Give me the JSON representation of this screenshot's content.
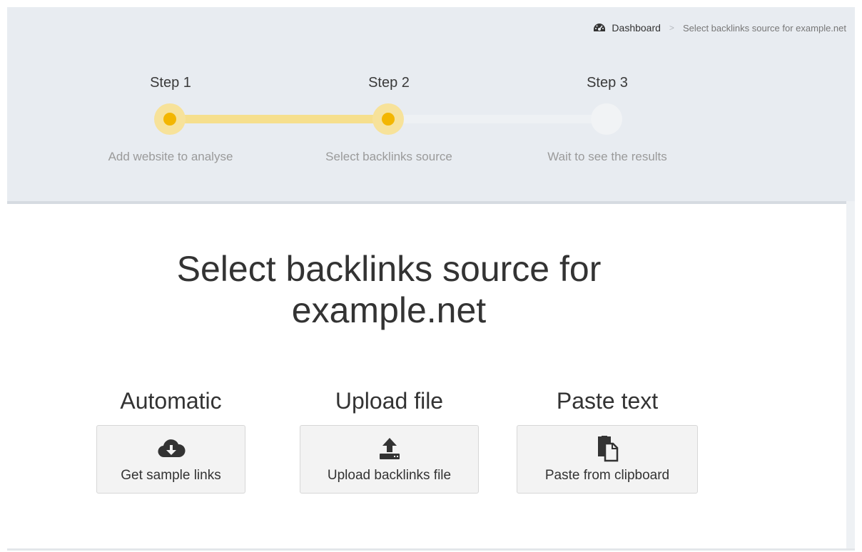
{
  "breadcrumb": {
    "icon": "dashboard-gauge-icon",
    "home_label": "Dashboard",
    "separator": ">",
    "current": "Select backlinks source for example.net"
  },
  "steps": [
    {
      "title": "Step 1",
      "description": "Add website to analyse",
      "state": "complete"
    },
    {
      "title": "Step 2",
      "description": "Select backlinks source",
      "state": "current"
    },
    {
      "title": "Step 3",
      "description": "Wait to see the results",
      "state": "pending"
    }
  ],
  "main": {
    "title": "Select backlinks source for example.net",
    "options": [
      {
        "heading": "Automatic",
        "button_label": "Get sample links",
        "icon": "cloud-download-icon"
      },
      {
        "heading": "Upload file",
        "button_label": "Upload backlinks file",
        "icon": "upload-icon"
      },
      {
        "heading": "Paste text",
        "button_label": "Paste from clipboard",
        "icon": "clipboard-paste-icon"
      }
    ]
  },
  "colors": {
    "accent": "#f3b600",
    "accent_light": "#f6df8d",
    "header_bg": "#e8ecf1"
  }
}
